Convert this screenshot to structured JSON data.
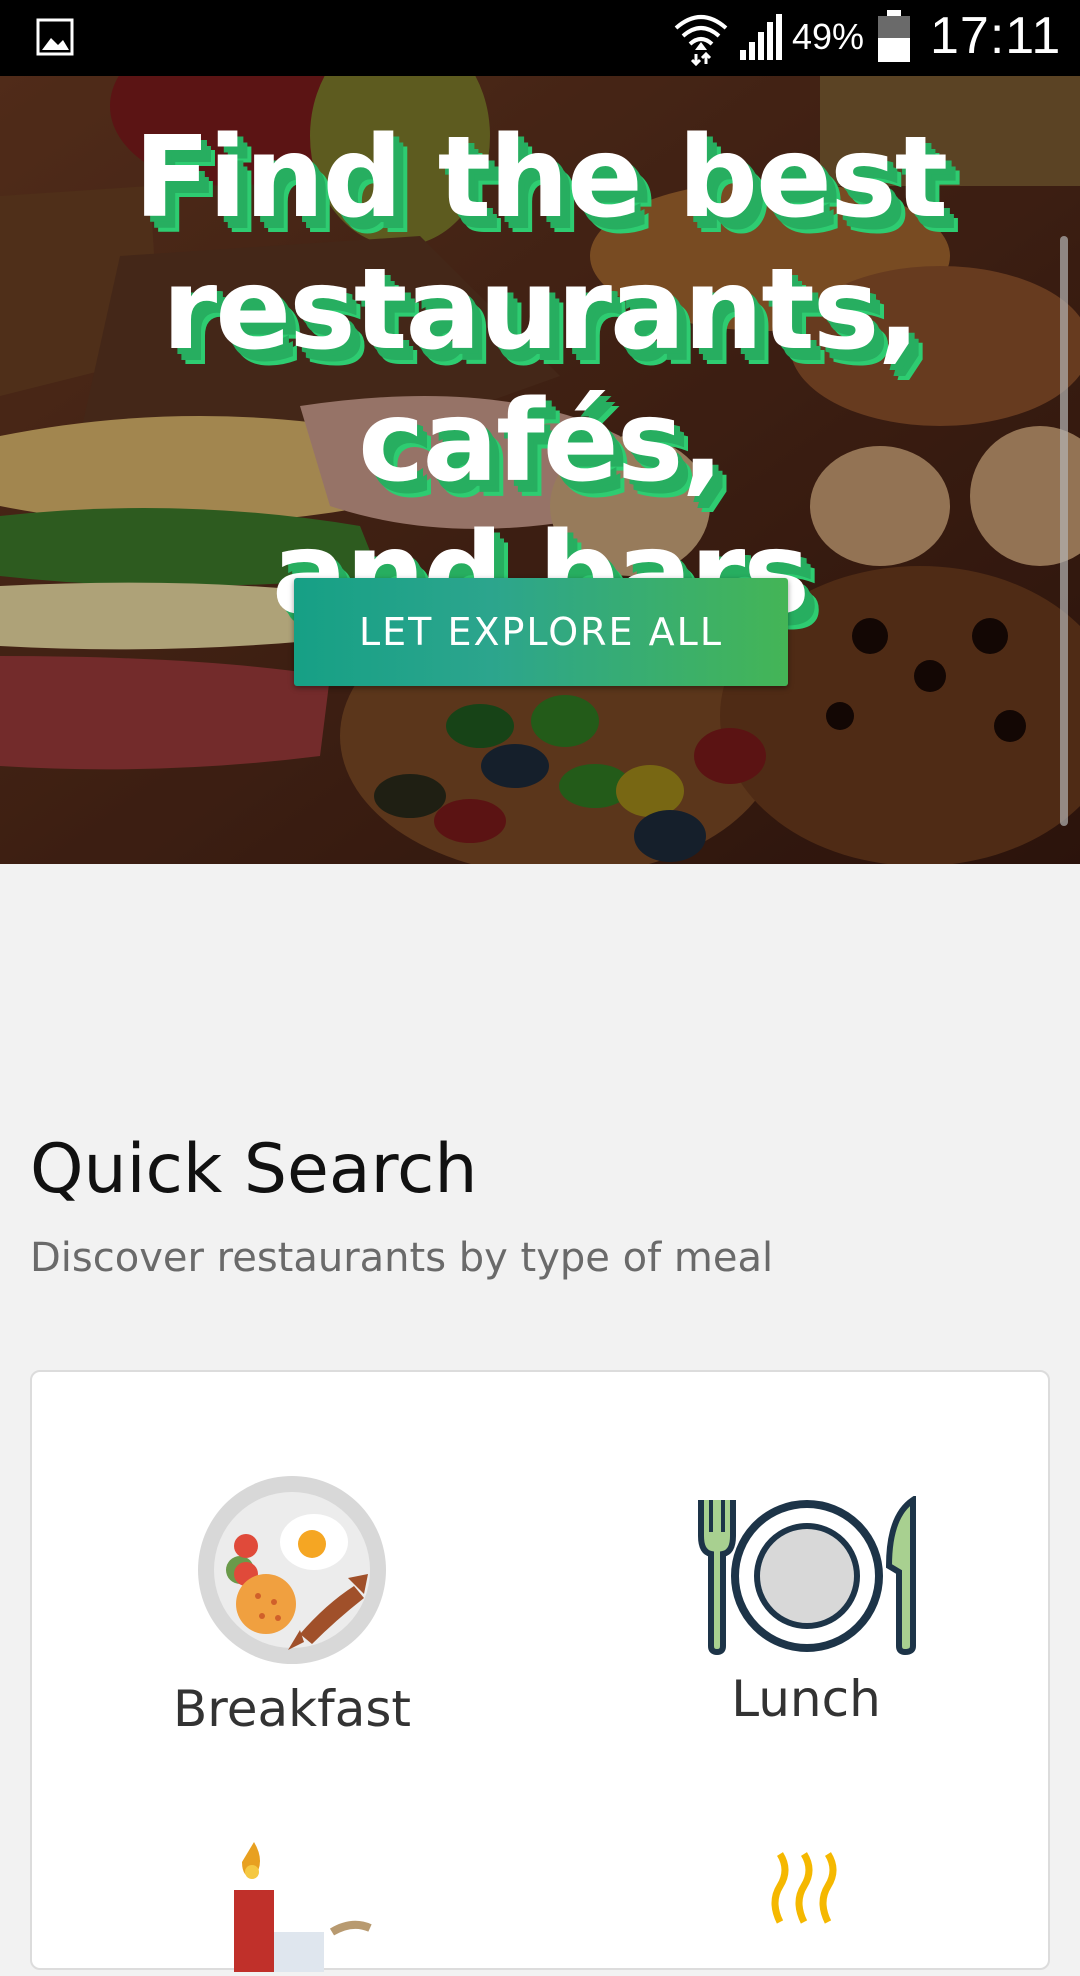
{
  "status_bar": {
    "battery_percent": "49%",
    "time": "17:11",
    "icons": [
      "gallery-icon",
      "wifi-icon",
      "signal-icon",
      "battery-icon"
    ]
  },
  "hero": {
    "title_line1": "Find the best",
    "title_line2": "restaurants, cafés,",
    "title_line3": "and bars",
    "cta_label": "LET EXPLORE ALL",
    "accent_color": "#27ae60"
  },
  "quick_search": {
    "title": "Quick Search",
    "subtitle": "Discover restaurants by type of meal",
    "meals": [
      {
        "label": "Breakfast",
        "icon": "breakfast-plate-icon"
      },
      {
        "label": "Lunch",
        "icon": "plate-fork-knife-icon"
      },
      {
        "label": "",
        "icon": "candle-icon"
      },
      {
        "label": "",
        "icon": "steam-icon"
      }
    ]
  }
}
